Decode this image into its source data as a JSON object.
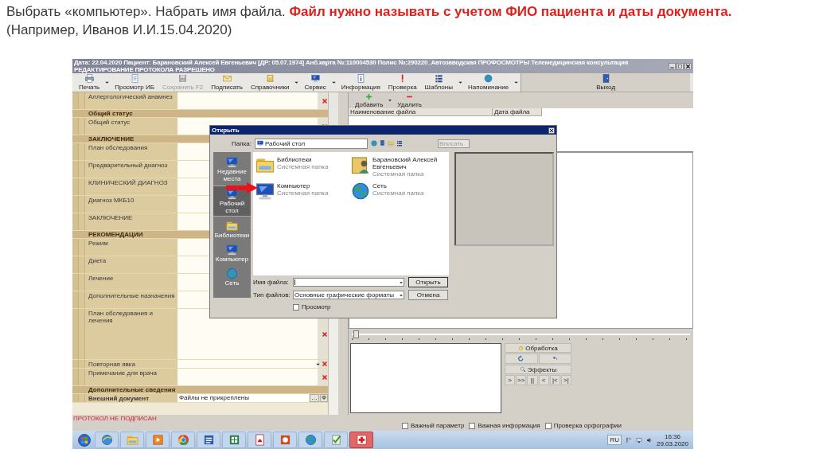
{
  "slide": {
    "lines": [
      "Выбрать «компьютер». Набрать имя файла. **Файл нужно называть с учетом ФИО пациента и даты документа.**",
      "(Например, Иванов И.И.15.04.2020)"
    ]
  },
  "window": {
    "title": "Дата: 22.04.2020 Пациент: Барановский Алексей Евгеньевич  [ДР: 05.07.1974]  Анб.карта №:110004530  Полис №:290220_Автозаводская ПРОФОСМОТРЫ Телемедицинская консультация РЕДАКТИРОВАНИЕ ПРОТОКОЛА РАЗРЕШЕНО"
  },
  "toolbar": [
    {
      "kind": "print",
      "label": "Печать",
      "disabled": false,
      "menu": true
    },
    {
      "kind": "view",
      "label": "Просмотр ИБ",
      "disabled": false,
      "menu": false
    },
    {
      "kind": "save",
      "label": "Сохранить F2",
      "disabled": true,
      "menu": false
    },
    {
      "kind": "sign",
      "label": "Подписать",
      "disabled": false,
      "menu": false
    },
    {
      "kind": "ref",
      "label": "Справочники",
      "disabled": false,
      "menu": true
    },
    {
      "kind": "service",
      "label": "Сервис",
      "disabled": false,
      "menu": true
    },
    {
      "kind": "info",
      "label": "Информация",
      "disabled": false,
      "menu": false
    },
    {
      "kind": "check",
      "label": "Проверка",
      "disabled": false,
      "menu": false
    },
    {
      "kind": "templates",
      "label": "Шаблоны",
      "disabled": false,
      "menu": true
    },
    {
      "kind": "reminder",
      "label": "Напоминание",
      "disabled": false,
      "menu": true
    },
    {
      "kind": "exit",
      "label": "Выход",
      "disabled": false,
      "menu": false
    }
  ],
  "form": {
    "rows": [
      {
        "kind": "field",
        "label": "Аллергологический анамнез",
        "clear": true
      },
      {
        "kind": "section",
        "label": "Общий статус"
      },
      {
        "kind": "field",
        "label": "Общий статус",
        "clear": true
      },
      {
        "kind": "section",
        "label": "ЗАКЛЮЧЕНИЕ"
      },
      {
        "kind": "field",
        "label": "План обследования",
        "clear": false
      },
      {
        "kind": "field",
        "label": "Предварительный диагноз",
        "clear": false
      },
      {
        "kind": "field",
        "label": "КЛИНИЧЕСКИЙ ДИАГНОЗ",
        "clear": false
      },
      {
        "kind": "field",
        "label": "Диагноз МКБ10",
        "clear": false
      },
      {
        "kind": "field",
        "label": "ЗАКЛЮЧЕНИЕ",
        "clear": false
      },
      {
        "kind": "section",
        "label": "РЕКОМЕНДАЦИИ"
      },
      {
        "kind": "field",
        "label": "Режим",
        "clear": false
      },
      {
        "kind": "field",
        "label": "Диета",
        "clear": false
      },
      {
        "kind": "field",
        "label": "Лечение",
        "clear": false
      },
      {
        "kind": "field",
        "label": "Дополнительные назначения",
        "clear": false
      },
      {
        "kind": "memo",
        "label": "План обследования и лечения",
        "clear": true
      },
      {
        "kind": "dropdown",
        "label": "Повторная явка",
        "clear": true
      },
      {
        "kind": "field",
        "label": "Примечание для врача",
        "clear": true
      },
      {
        "kind": "section",
        "label": "Дополнительные сведения"
      },
      {
        "kind": "file",
        "label": "Внешний документ",
        "value": "Файлы не прикреплены",
        "buttons": [
          "…",
          "Ф"
        ]
      }
    ]
  },
  "status": "ПРОТОКОЛ НЕ ПОДПИСАН",
  "options": [
    {
      "label": "Важный параметр",
      "checked": false
    },
    {
      "label": "Важная информация",
      "checked": false
    },
    {
      "label": "Проверка орфографии",
      "checked": false
    }
  ],
  "files": {
    "actions": [
      {
        "kind": "add",
        "label": "Добавить",
        "menu": true
      },
      {
        "kind": "remove",
        "label": "Удалить",
        "menu": false
      }
    ],
    "columns": [
      "Наименование файла",
      "Дата файла"
    ]
  },
  "image_tools": {
    "processing": "Обработка",
    "effects": "Эффекты",
    "playback": [
      ">",
      ">>",
      "||",
      "<",
      "|<",
      ">|"
    ]
  },
  "dialog": {
    "title": "Открыть",
    "folder_label": "Папка:",
    "folder": "Рабочий стол",
    "fit": {
      "value": "Вписать",
      "disabled": true
    },
    "places": [
      {
        "kind": "recent",
        "label": "Недавние места",
        "selected": false
      },
      {
        "kind": "desktop",
        "label": "Рабочий стол",
        "selected": true
      },
      {
        "kind": "library",
        "label": "Библиотеки",
        "selected": false
      },
      {
        "kind": "computer",
        "label": "Компьютер",
        "selected": false
      },
      {
        "kind": "network",
        "label": "Сеть",
        "selected": false
      }
    ],
    "items": [
      {
        "kind": "library",
        "name": "Библиотеки",
        "type": "Системная папка"
      },
      {
        "kind": "user",
        "name": "Барановский Алексей Евгеньевич",
        "type": "Системная папка"
      },
      {
        "kind": "computer",
        "name": "Компьютер",
        "type": "Системная папка"
      },
      {
        "kind": "network",
        "name": "Сеть",
        "type": "Системная папка"
      }
    ],
    "file_name_label": "Имя файла:",
    "file_type_label": "Тип файлов:",
    "file_type": "Основные графические форматы",
    "buttons": [
      "Открыть",
      "Отмена"
    ],
    "preview": {
      "label": "Просмотр",
      "checked": false
    }
  },
  "taskbar": {
    "apps": [
      {
        "kind": "browser",
        "selected": false
      },
      {
        "kind": "library",
        "selected": false
      },
      {
        "kind": "media",
        "selected": false
      },
      {
        "kind": "chrome",
        "selected": false
      },
      {
        "kind": "word",
        "selected": false
      },
      {
        "kind": "excel",
        "selected": false
      },
      {
        "kind": "pdf",
        "selected": false
      },
      {
        "kind": "ppt",
        "selected": false
      },
      {
        "kind": "network",
        "selected": false
      },
      {
        "kind": "tool",
        "selected": false
      },
      {
        "kind": "medical",
        "selected": true
      }
    ],
    "language": "RU",
    "time": "16:36",
    "date": "29.03.2020"
  }
}
